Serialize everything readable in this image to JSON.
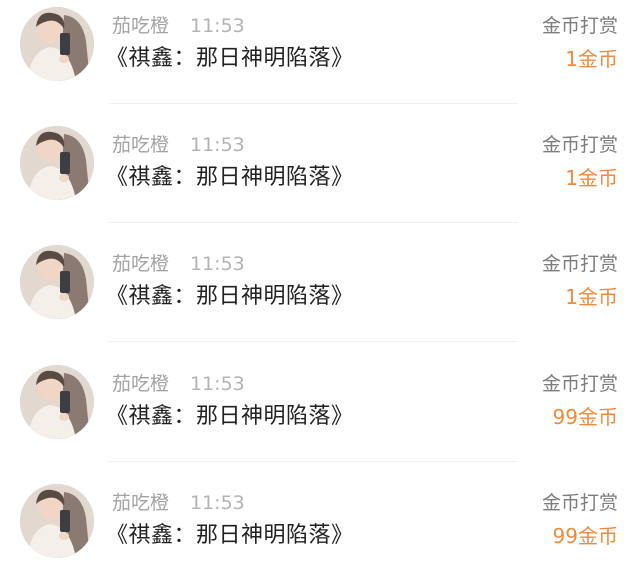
{
  "items": [
    {
      "name": "茄吃橙",
      "time": "11:53",
      "title": "《祺鑫：那日神明陷落》",
      "action": "金币打赏",
      "amount": "1金币",
      "avatar": "user-avatar"
    },
    {
      "name": "茄吃橙",
      "time": "11:53",
      "title": "《祺鑫：那日神明陷落》",
      "action": "金币打赏",
      "amount": "1金币",
      "avatar": "user-avatar"
    },
    {
      "name": "茄吃橙",
      "time": "11:53",
      "title": "《祺鑫：那日神明陷落》",
      "action": "金币打赏",
      "amount": "1金币",
      "avatar": "user-avatar"
    },
    {
      "name": "茄吃橙",
      "time": "11:53",
      "title": "《祺鑫：那日神明陷落》",
      "action": "金币打赏",
      "amount": "99金币",
      "avatar": "user-avatar"
    },
    {
      "name": "茄吃橙",
      "time": "11:53",
      "title": "《祺鑫：那日神明陷落》",
      "action": "金币打赏",
      "amount": "99金币",
      "avatar": "user-avatar"
    }
  ],
  "colors": {
    "amount": "#f08a3c",
    "name": "#a3a3a3",
    "title": "#222222",
    "action": "#7d7d7d"
  }
}
